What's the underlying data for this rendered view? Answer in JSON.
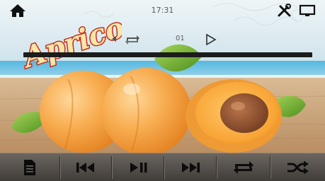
{
  "status": {
    "time": "17:31",
    "home_icon": "home-icon",
    "tools_icon": "tools-icon",
    "display_icon": "display-icon"
  },
  "track_info": {
    "track_number": "01",
    "repeat_icon": "repeat-icon",
    "play_icon": "play-outline-icon"
  },
  "logo": {
    "text": "Apricot"
  },
  "progress": {
    "value_fraction": 0.0
  },
  "controls": [
    {
      "name": "playlist-button",
      "icon": "document-list-icon"
    },
    {
      "name": "previous-track-button",
      "icon": "skip-previous-icon"
    },
    {
      "name": "play-pause-button",
      "icon": "play-pause-icon"
    },
    {
      "name": "next-track-button",
      "icon": "skip-next-icon"
    },
    {
      "name": "repeat-button",
      "icon": "repeat-icon"
    },
    {
      "name": "shuffle-button",
      "icon": "shuffle-icon"
    }
  ],
  "colors": {
    "apricot": "#f6a23e",
    "leaf": "#6fae2c",
    "table": "#c9a27a",
    "control_bar": "#55504a",
    "logo_red": "#c0311f"
  }
}
